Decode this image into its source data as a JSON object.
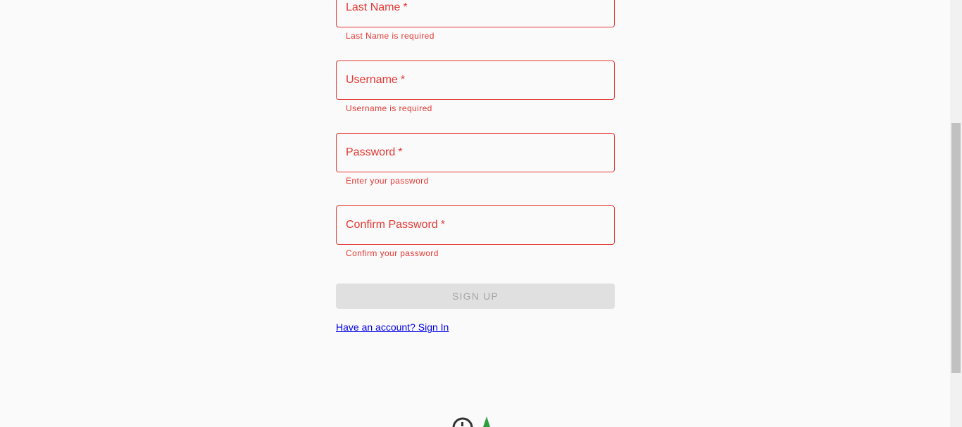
{
  "form": {
    "fields": [
      {
        "label": "Last Name",
        "required_mark": "*",
        "error": "Last Name is required"
      },
      {
        "label": "Username",
        "required_mark": "*",
        "error": "Username is required"
      },
      {
        "label": "Password",
        "required_mark": "*",
        "error": "Enter your password"
      },
      {
        "label": "Confirm Password",
        "required_mark": "*",
        "error": "Confirm your password"
      }
    ],
    "submit_label": "SIGN UP",
    "signin_link": "Have an account? Sign In"
  },
  "colors": {
    "error": "#e53935",
    "background": "#fafafa",
    "disabled_button": "#e0e0e0",
    "link": "#0000ee",
    "logo_green": "#2e9e3f",
    "logo_dark": "#333333"
  },
  "footer": {
    "logo_icon": "app-logo-icon"
  }
}
